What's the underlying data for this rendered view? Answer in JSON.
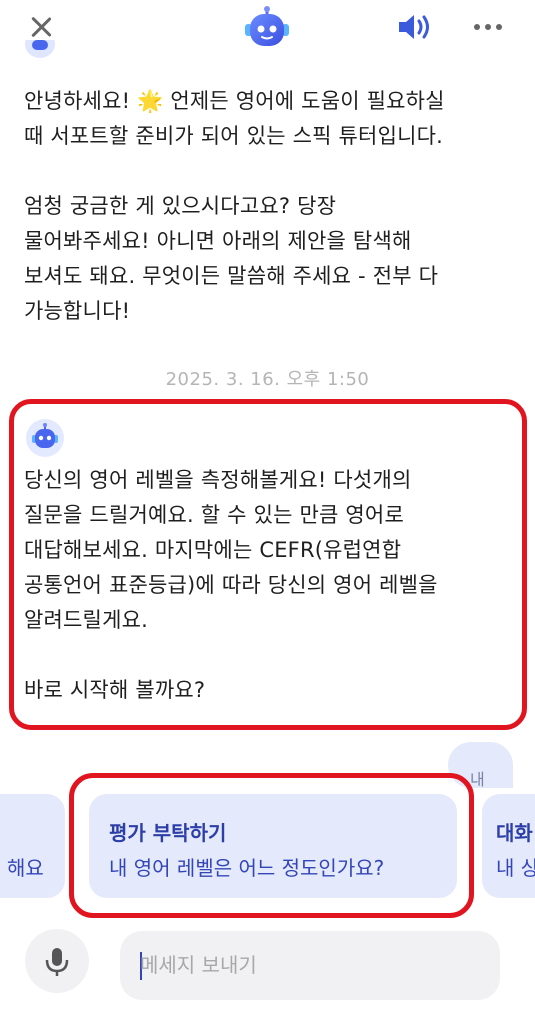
{
  "header": {
    "close_icon": "close-icon",
    "logo_icon": "robot-logo-icon",
    "speaker_icon": "speaker-icon",
    "more_icon": "more-horizontal-icon",
    "accent_color": "#3b5bdb"
  },
  "messages": [
    {
      "sender": "bot",
      "text": "안녕하세요! 🌟 언제든 영어에 도움이 필요하실\n때 서포트할 준비가 되어 있는 스픽 튜터입니다.\n\n엄청 궁금한 게 있으시다고요? 당장\n물어봐주세요! 아니면 아래의 제안을 탐색해\n보셔도 돼요. 무엇이든 말씀해 주세요 - 전부 다\n가능합니다!"
    },
    {
      "sender": "bot",
      "text": "당신의 영어 레벨을 측정해볼게요! 다섯개의\n질문을 드릴거예요. 할 수 있는 만큼 영어로\n대답해보세요. 마지막에는 CEFR(유럽연합\n공통언어 표준등급)에 따라 당신의 영어 레벨을\n알려드릴게요.\n\n바로 시작해 볼까요?"
    }
  ],
  "timestamp": "2025. 3. 16. 오후 1:50",
  "user_bubble_partial": "내",
  "suggestions": [
    {
      "title": "",
      "subtitle": "해요"
    },
    {
      "title": "평가 부탁하기",
      "subtitle": "내 영어 레벨은 어느 정도인가요?"
    },
    {
      "title": "대화",
      "subtitle": "내 상"
    }
  ],
  "input": {
    "placeholder": "메세지 보내기",
    "value": "",
    "mic_icon": "microphone-icon"
  },
  "colors": {
    "highlight": "#e0151f",
    "chip_bg": "#e4e9fb",
    "chip_text": "#2c3ea8"
  }
}
